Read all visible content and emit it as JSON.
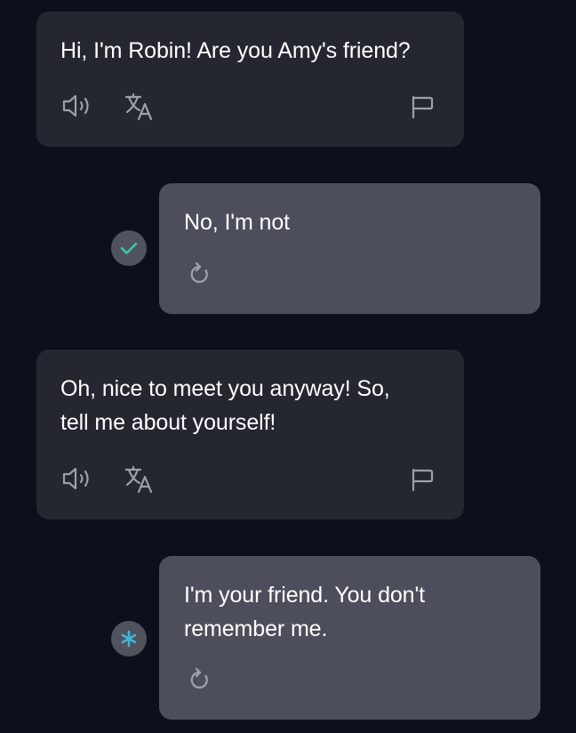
{
  "colors": {
    "background": "#0c101c",
    "bot_bubble": "#242730",
    "user_bubble": "#4c4f5b",
    "icon": "#9ba0ab",
    "check_accent": "#3fc6a0",
    "asterisk_accent": "#3fb6d8"
  },
  "messages": [
    {
      "role": "bot",
      "text": "Hi, I'm Robin! Are you Amy's friend?",
      "icons": [
        "speaker-icon",
        "translate-icon",
        "flag-icon"
      ]
    },
    {
      "role": "user",
      "text": "No, I'm not",
      "status_icon": "check-icon",
      "icons": [
        "retry-icon"
      ]
    },
    {
      "role": "bot",
      "text": "Oh, nice to meet you anyway! So,\ntell me about yourself!",
      "icons": [
        "speaker-icon",
        "translate-icon",
        "flag-icon"
      ]
    },
    {
      "role": "user",
      "text": "I'm your friend. You don't\nremember me.",
      "status_icon": "asterisk-icon",
      "icons": [
        "retry-icon"
      ]
    }
  ]
}
